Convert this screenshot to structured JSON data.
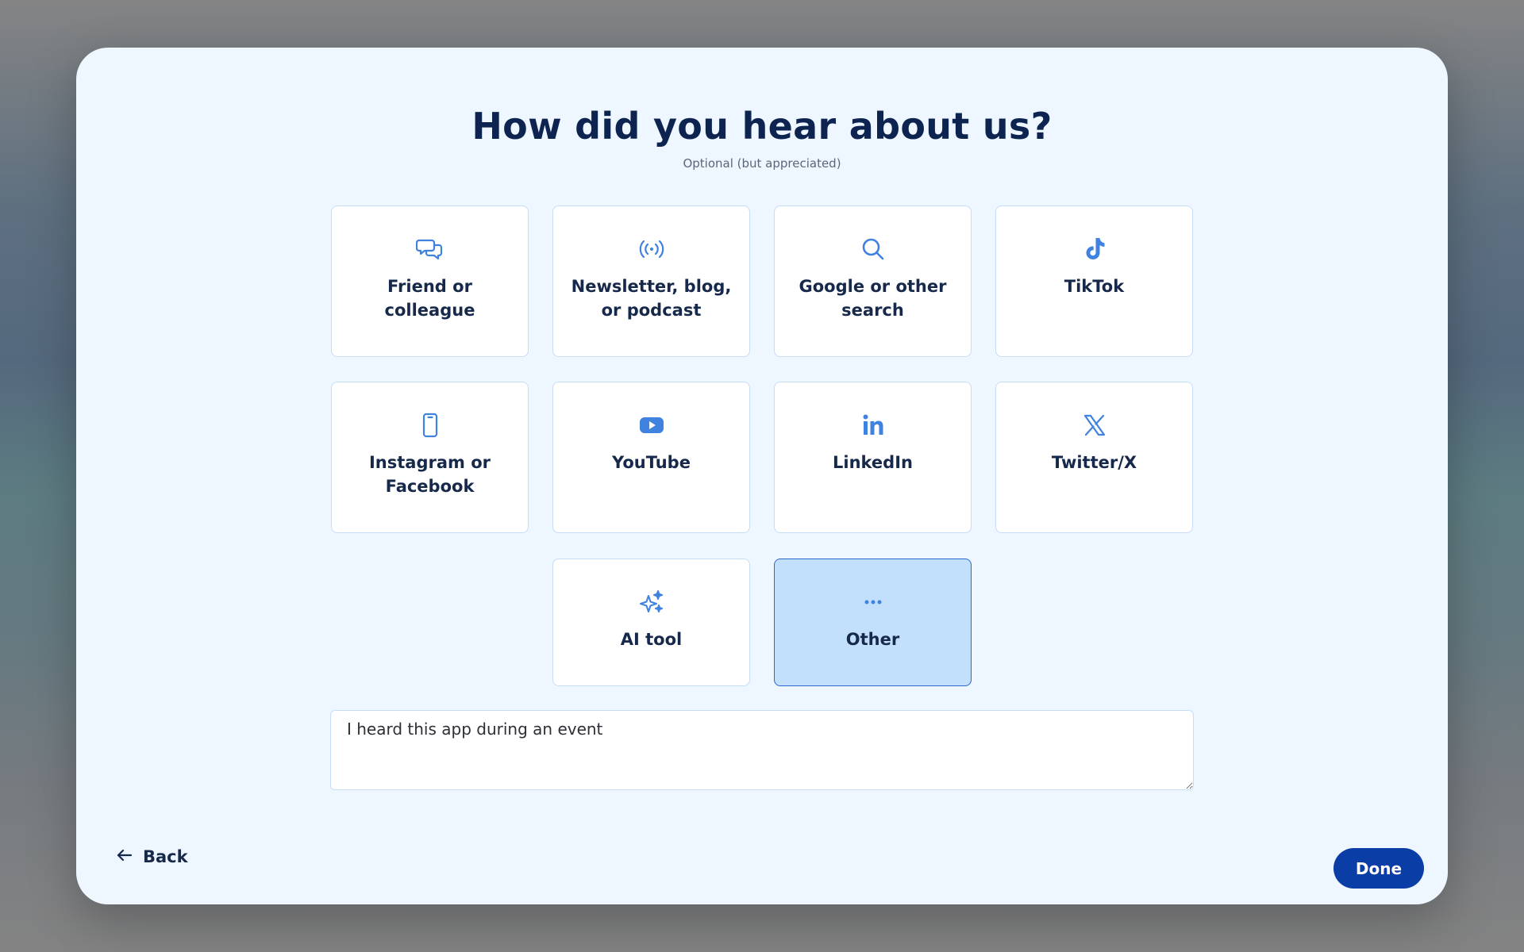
{
  "dialog": {
    "title": "How did you hear about us?",
    "subtitle": "Optional (but appreciated)"
  },
  "options": [
    {
      "label": "Friend or colleague",
      "icon": "chat-bubbles-icon",
      "selected": false
    },
    {
      "label": "Newsletter, blog, or podcast",
      "icon": "broadcast-icon",
      "selected": false
    },
    {
      "label": "Google or other search",
      "icon": "search-icon",
      "selected": false
    },
    {
      "label": "TikTok",
      "icon": "tiktok-icon",
      "selected": false
    },
    {
      "label": "Instagram or Facebook",
      "icon": "phone-icon",
      "selected": false
    },
    {
      "label": "YouTube",
      "icon": "youtube-icon",
      "selected": false
    },
    {
      "label": "LinkedIn",
      "icon": "linkedin-icon",
      "selected": false
    },
    {
      "label": "Twitter/X",
      "icon": "x-icon",
      "selected": false
    },
    {
      "label": "AI tool",
      "icon": "sparkles-icon",
      "selected": false
    },
    {
      "label": "Other",
      "icon": "more-icon",
      "selected": true
    }
  ],
  "other_input": {
    "value": "I heard this app during an event"
  },
  "footer": {
    "back_label": "Back",
    "done_label": "Done"
  },
  "colors": {
    "accent": "#3f82e0",
    "primary_button": "#0b3da6",
    "selected_background": "#c2dffc",
    "heading": "#0d2451"
  }
}
